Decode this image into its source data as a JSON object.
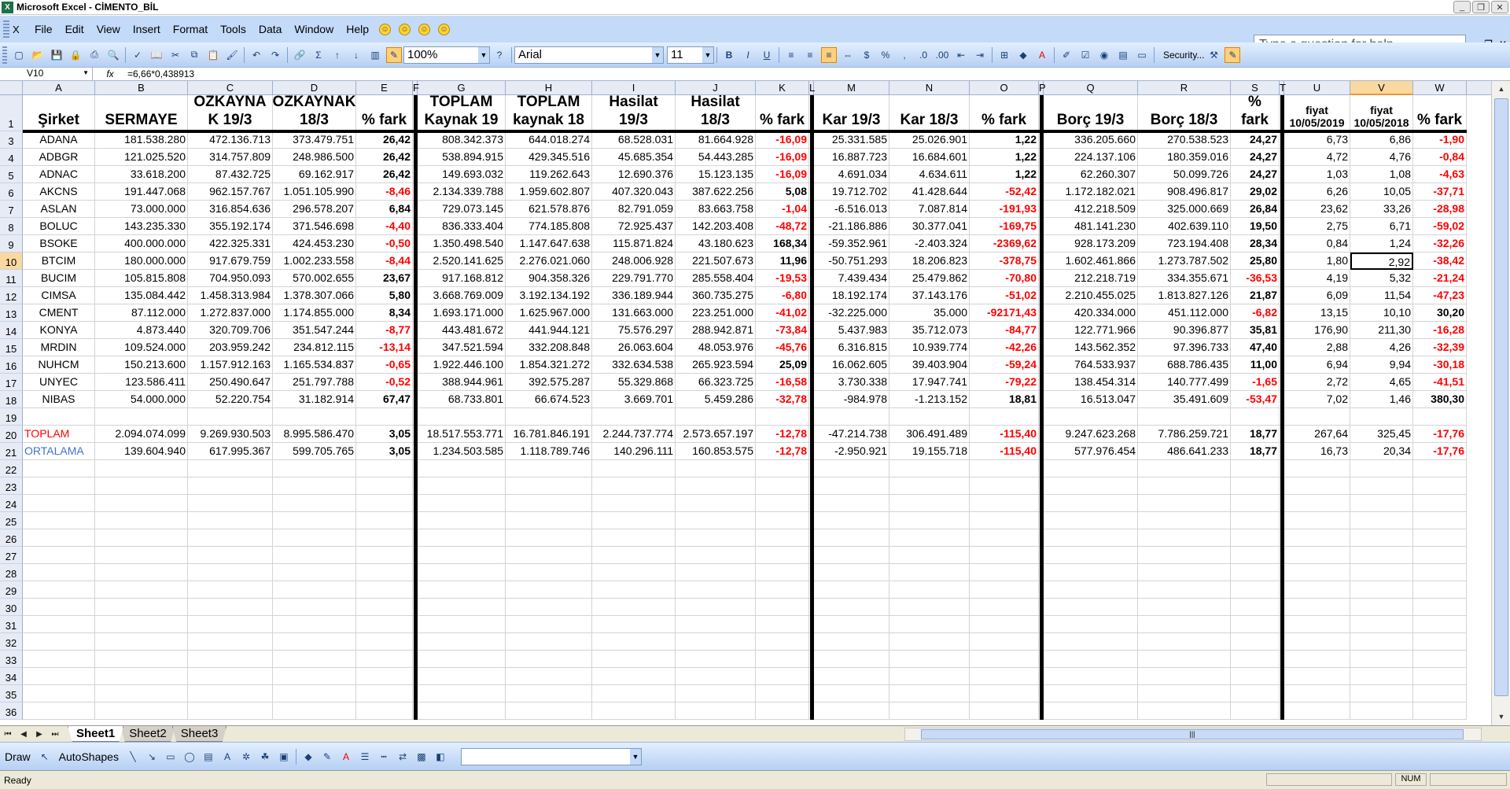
{
  "window": {
    "title": "Microsoft Excel - CİMENTO_BİL"
  },
  "menu": {
    "items": [
      "File",
      "Edit",
      "View",
      "Insert",
      "Format",
      "Tools",
      "Data",
      "Window",
      "Help"
    ],
    "help_placeholder": "Type a question for help"
  },
  "toolbar": {
    "zoom": "100%",
    "font": "Arial",
    "size": "11",
    "security": "Security..."
  },
  "formula": {
    "namebox": "V10",
    "fx": "fx",
    "value": "=6,66*0,438913"
  },
  "columns": [
    "A",
    "B",
    "C",
    "D",
    "E",
    "F",
    "G",
    "H",
    "I",
    "J",
    "K",
    "L",
    "M",
    "N",
    "O",
    "P",
    "Q",
    "R",
    "S",
    "T",
    "U",
    "V",
    "W"
  ],
  "row_numbers": [
    "1",
    "3",
    "4",
    "5",
    "6",
    "7",
    "8",
    "9",
    "10",
    "11",
    "12",
    "13",
    "14",
    "15",
    "16",
    "17",
    "18",
    "19",
    "20",
    "21",
    "22",
    "23",
    "24",
    "25",
    "26",
    "27",
    "28",
    "29",
    "30",
    "31",
    "32",
    "33",
    "34",
    "35",
    "36"
  ],
  "headers": {
    "A": "Şirket",
    "B": "SERMAYE",
    "C": "ÖZKAYNA K 19/3",
    "D": "ÖZKAYNAK 18/3",
    "E": "% fark",
    "G": "TOPLAM Kaynak 19",
    "H": "TOPLAM kaynak 18",
    "I": "Hasilat 19/3",
    "J": "Hasilat 18/3",
    "K": "% fark",
    "M": "Kar 19/3",
    "N": "Kar 18/3",
    "O": "% fark",
    "Q": "Borç 19/3",
    "R": "Borç 18/3",
    "S": "% fark",
    "U": "fiyat 10/05/2019",
    "V": "fiyat 10/05/2018",
    "W": "% fark"
  },
  "rows": [
    {
      "A": "ADANA",
      "B": "181.538.280",
      "C": "472.136.713",
      "D": "373.479.751",
      "E": "26,42",
      "G": "808.342.373",
      "H": "644.018.274",
      "I": "68.528.031",
      "J": "81.664.928",
      "K": "-16,09",
      "M": "25.331.585",
      "N": "25.026.901",
      "O": "1,22",
      "Q": "336.205.660",
      "R": "270.538.523",
      "S": "24,27",
      "U": "6,73",
      "V": "6,86",
      "W": "-1,90"
    },
    {
      "A": "ADBGR",
      "B": "121.025.520",
      "C": "314.757.809",
      "D": "248.986.500",
      "E": "26,42",
      "G": "538.894.915",
      "H": "429.345.516",
      "I": "45.685.354",
      "J": "54.443.285",
      "K": "-16,09",
      "M": "16.887.723",
      "N": "16.684.601",
      "O": "1,22",
      "Q": "224.137.106",
      "R": "180.359.016",
      "S": "24,27",
      "U": "4,72",
      "V": "4,76",
      "W": "-0,84"
    },
    {
      "A": "ADNAC",
      "B": "33.618.200",
      "C": "87.432.725",
      "D": "69.162.917",
      "E": "26,42",
      "G": "149.693.032",
      "H": "119.262.643",
      "I": "12.690.376",
      "J": "15.123.135",
      "K": "-16,09",
      "M": "4.691.034",
      "N": "4.634.611",
      "O": "1,22",
      "Q": "62.260.307",
      "R": "50.099.726",
      "S": "24,27",
      "U": "1,03",
      "V": "1,08",
      "W": "-4,63"
    },
    {
      "A": "AKCNS",
      "B": "191.447.068",
      "C": "962.157.767",
      "D": "1.051.105.990",
      "E": "-8,46",
      "G": "2.134.339.788",
      "H": "1.959.602.807",
      "I": "407.320.043",
      "J": "387.622.256",
      "K": "5,08",
      "M": "19.712.702",
      "N": "41.428.644",
      "O": "-52,42",
      "Q": "1.172.182.021",
      "R": "908.496.817",
      "S": "29,02",
      "U": "6,26",
      "V": "10,05",
      "W": "-37,71"
    },
    {
      "A": "ASLAN",
      "B": "73.000.000",
      "C": "316.854.636",
      "D": "296.578.207",
      "E": "6,84",
      "G": "729.073.145",
      "H": "621.578.876",
      "I": "82.791.059",
      "J": "83.663.758",
      "K": "-1,04",
      "M": "-6.516.013",
      "N": "7.087.814",
      "O": "-191,93",
      "Q": "412.218.509",
      "R": "325.000.669",
      "S": "26,84",
      "U": "23,62",
      "V": "33,26",
      "W": "-28,98"
    },
    {
      "A": "BOLUC",
      "B": "143.235.330",
      "C": "355.192.174",
      "D": "371.546.698",
      "E": "-4,40",
      "G": "836.333.404",
      "H": "774.185.808",
      "I": "72.925.437",
      "J": "142.203.408",
      "K": "-48,72",
      "M": "-21.186.886",
      "N": "30.377.041",
      "O": "-169,75",
      "Q": "481.141.230",
      "R": "402.639.110",
      "S": "19,50",
      "U": "2,75",
      "V": "6,71",
      "W": "-59,02"
    },
    {
      "A": "BSOKE",
      "B": "400.000.000",
      "C": "422.325.331",
      "D": "424.453.230",
      "E": "-0,50",
      "G": "1.350.498.540",
      "H": "1.147.647.638",
      "I": "115.871.824",
      "J": "43.180.623",
      "K": "168,34",
      "M": "-59.352.961",
      "N": "-2.403.324",
      "O": "-2369,62",
      "Q": "928.173.209",
      "R": "723.194.408",
      "S": "28,34",
      "U": "0,84",
      "V": "1,24",
      "W": "-32,26"
    },
    {
      "A": "BTCIM",
      "B": "180.000.000",
      "C": "917.679.759",
      "D": "1.002.233.558",
      "E": "-8,44",
      "G": "2.520.141.625",
      "H": "2.276.021.060",
      "I": "248.006.928",
      "J": "221.507.673",
      "K": "11,96",
      "M": "-50.751.293",
      "N": "18.206.823",
      "O": "-378,75",
      "Q": "1.602.461.866",
      "R": "1.273.787.502",
      "S": "25,80",
      "U": "1,80",
      "V": "2,92",
      "W": "-38,42"
    },
    {
      "A": "BUCIM",
      "B": "105.815.808",
      "C": "704.950.093",
      "D": "570.002.655",
      "E": "23,67",
      "G": "917.168.812",
      "H": "904.358.326",
      "I": "229.791.770",
      "J": "285.558.404",
      "K": "-19,53",
      "M": "7.439.434",
      "N": "25.479.862",
      "O": "-70,80",
      "Q": "212.218.719",
      "R": "334.355.671",
      "S": "-36,53",
      "U": "4,19",
      "V": "5,32",
      "W": "-21,24"
    },
    {
      "A": "CIMSA",
      "B": "135.084.442",
      "C": "1.458.313.984",
      "D": "1.378.307.066",
      "E": "5,80",
      "G": "3.668.769.009",
      "H": "3.192.134.192",
      "I": "336.189.944",
      "J": "360.735.275",
      "K": "-6,80",
      "M": "18.192.174",
      "N": "37.143.176",
      "O": "-51,02",
      "Q": "2.210.455.025",
      "R": "1.813.827.126",
      "S": "21,87",
      "U": "6,09",
      "V": "11,54",
      "W": "-47,23"
    },
    {
      "A": "CMENT",
      "B": "87.112.000",
      "C": "1.272.837.000",
      "D": "1.174.855.000",
      "E": "8,34",
      "G": "1.693.171.000",
      "H": "1.625.967.000",
      "I": "131.663.000",
      "J": "223.251.000",
      "K": "-41,02",
      "M": "-32.225.000",
      "N": "35.000",
      "O": "-92171,43",
      "Q": "420.334.000",
      "R": "451.112.000",
      "S": "-6,82",
      "U": "13,15",
      "V": "10,10",
      "W": "30,20"
    },
    {
      "A": "KONYA",
      "B": "4.873.440",
      "C": "320.709.706",
      "D": "351.547.244",
      "E": "-8,77",
      "G": "443.481.672",
      "H": "441.944.121",
      "I": "75.576.297",
      "J": "288.942.871",
      "K": "-73,84",
      "M": "5.437.983",
      "N": "35.712.073",
      "O": "-84,77",
      "Q": "122.771.966",
      "R": "90.396.877",
      "S": "35,81",
      "U": "176,90",
      "V": "211,30",
      "W": "-16,28"
    },
    {
      "A": "MRDIN",
      "B": "109.524.000",
      "C": "203.959.242",
      "D": "234.812.115",
      "E": "-13,14",
      "G": "347.521.594",
      "H": "332.208.848",
      "I": "26.063.604",
      "J": "48.053.976",
      "K": "-45,76",
      "M": "6.316.815",
      "N": "10.939.774",
      "O": "-42,26",
      "Q": "143.562.352",
      "R": "97.396.733",
      "S": "47,40",
      "U": "2,88",
      "V": "4,26",
      "W": "-32,39"
    },
    {
      "A": "NUHCM",
      "B": "150.213.600",
      "C": "1.157.912.163",
      "D": "1.165.534.837",
      "E": "-0,65",
      "G": "1.922.446.100",
      "H": "1.854.321.272",
      "I": "332.634.538",
      "J": "265.923.594",
      "K": "25,09",
      "M": "16.062.605",
      "N": "39.403.904",
      "O": "-59,24",
      "Q": "764.533.937",
      "R": "688.786.435",
      "S": "11,00",
      "U": "6,94",
      "V": "9,94",
      "W": "-30,18"
    },
    {
      "A": "UNYEC",
      "B": "123.586.411",
      "C": "250.490.647",
      "D": "251.797.788",
      "E": "-0,52",
      "G": "388.944.961",
      "H": "392.575.287",
      "I": "55.329.868",
      "J": "66.323.725",
      "K": "-16,58",
      "M": "3.730.338",
      "N": "17.947.741",
      "O": "-79,22",
      "Q": "138.454.314",
      "R": "140.777.499",
      "S": "-1,65",
      "U": "2,72",
      "V": "4,65",
      "W": "-41,51"
    },
    {
      "A": "NIBAS",
      "B": "54.000.000",
      "C": "52.220.754",
      "D": "31.182.914",
      "E": "67,47",
      "G": "68.733.801",
      "H": "66.674.523",
      "I": "3.669.701",
      "J": "5.459.286",
      "K": "-32,78",
      "M": "-984.978",
      "N": "-1.213.152",
      "O": "18,81",
      "Q": "16.513.047",
      "R": "35.491.609",
      "S": "-53,47",
      "U": "7,02",
      "V": "1,46",
      "W": "380,30"
    }
  ],
  "totals": [
    {
      "A": "TOPLAM",
      "B": "2.094.074.099",
      "C": "9.269.930.503",
      "D": "8.995.586.470",
      "E": "3,05",
      "G": "18.517.553.771",
      "H": "16.781.846.191",
      "I": "2.244.737.774",
      "J": "2.573.657.197",
      "K": "-12,78",
      "M": "-47.214.738",
      "N": "306.491.489",
      "O": "-115,40",
      "Q": "9.247.623.268",
      "R": "7.786.259.721",
      "S": "18,77",
      "U": "267,64",
      "V": "325,45",
      "W": "-17,76"
    },
    {
      "A": "ORTALAMA",
      "B": "139.604.940",
      "C": "617.995.367",
      "D": "599.705.765",
      "E": "3,05",
      "G": "1.234.503.585",
      "H": "1.118.789.746",
      "I": "140.296.111",
      "J": "160.853.575",
      "K": "-12,78",
      "M": "-2.950.921",
      "N": "19.155.718",
      "O": "-115,40",
      "Q": "577.976.454",
      "R": "486.641.233",
      "S": "18,77",
      "U": "16,73",
      "V": "20,34",
      "W": "-17,76"
    }
  ],
  "sheets": [
    "Sheet1",
    "Sheet2",
    "Sheet3"
  ],
  "drawbar": {
    "draw": "Draw",
    "autoshapes": "AutoShapes"
  },
  "status": {
    "text": "Ready",
    "num": "NUM"
  }
}
